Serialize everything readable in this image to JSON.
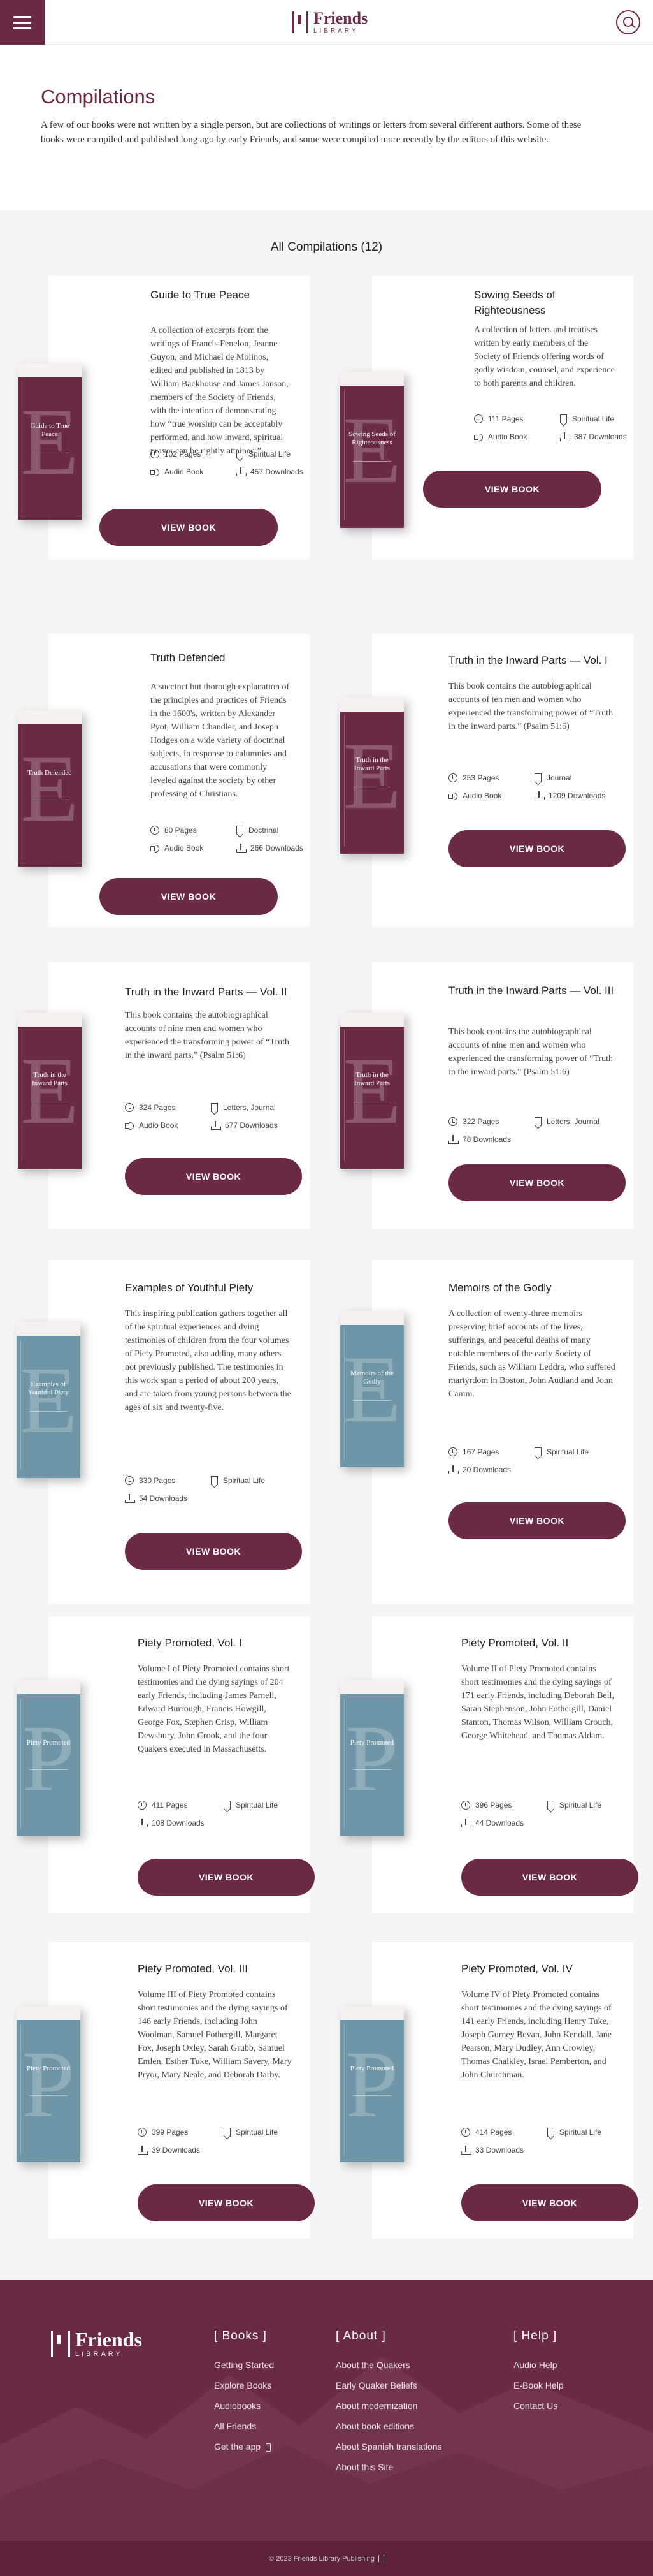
{
  "brand": {
    "name": "Friends",
    "sub": "LIBRARY"
  },
  "intro": {
    "title": "Compilations",
    "text": "A few of our books were not written by a single person, but are collections of writings or letters from several different authors. Some of these books were compiled and published long ago by early Friends, and some were compiled more recently by the editors of this website."
  },
  "count_label": "All Compilations (12)",
  "colors": {
    "accent": "#6c2b45",
    "cover_maroon": "#6b2b44",
    "cover_blue": "#6f96a6"
  },
  "books": [
    {
      "title": "Guide to True Peace",
      "cover_title": "Guide to True Peace",
      "cover_letter": "E",
      "cover_color": "maroon",
      "desc": "A collection of excerpts from the writings of Francis Fenelon, Jeanne Guyon, and Michael de Molinos, edited and published in 1813 by William Backhouse and James Janson, members of the Society of Friends, with the intention of demonstrating how “true worship can be acceptably performed, and how inward, spiritual prayer can be rightly attained.”",
      "pages": "102 Pages",
      "genre": "Spiritual Life",
      "audio": "Audio Book",
      "downloads": "457 Downloads",
      "button": "VIEW BOOK"
    },
    {
      "title": "Sowing Seeds of Righteousness",
      "cover_title": "Sowing Seeds of Righteousness",
      "cover_letter": "E",
      "cover_color": "maroon",
      "desc": "A collection of letters and treatises written by early members of the Society of Friends offering words of godly wisdom, counsel, and experience to both parents and children.",
      "pages": "111 Pages",
      "genre": "Spiritual Life",
      "audio": "Audio Book",
      "downloads": "387 Downloads",
      "button": "VIEW BOOK"
    },
    {
      "title": "Truth Defended",
      "cover_title": "Truth Defended",
      "cover_letter": "E",
      "cover_color": "maroon",
      "desc": "A succinct but thorough explanation of the principles and practices of Friends in the 1600's, written by Alexander Pyot, William Chandler, and Joseph Hodges on a wide variety of doctrinal subjects, in response to calumnies and accusations that were commonly leveled against the society by other professing of Christians.",
      "pages": "80 Pages",
      "genre": "Doctrinal",
      "audio": "Audio Book",
      "downloads": "266 Downloads",
      "button": "VIEW BOOK"
    },
    {
      "title": "Truth in the Inward Parts — Vol. I",
      "cover_title": "Truth in the Inward Parts",
      "cover_letter": "E",
      "cover_color": "maroon",
      "desc": "This book contains the autobiographical accounts of ten men and women who experienced the transforming power of “Truth in the inward parts.” (Psalm 51:6)",
      "pages": "253 Pages",
      "genre": "Journal",
      "audio": "Audio Book",
      "downloads": "1209 Downloads",
      "button": "VIEW BOOK"
    },
    {
      "title": "Truth in the Inward Parts — Vol. II",
      "cover_title": "Truth in the Inward Parts",
      "cover_letter": "E",
      "cover_color": "maroon",
      "desc": "This book contains the autobiographical accounts of nine men and women who experienced the transforming power of “Truth in the inward parts.” (Psalm 51:6)",
      "pages": "324 Pages",
      "genre": "Letters, Journal",
      "audio": "Audio Book",
      "downloads": "677 Downloads",
      "button": "VIEW BOOK"
    },
    {
      "title": "Truth in the Inward Parts — Vol. III",
      "cover_title": "Truth in the Inward Parts",
      "cover_letter": "E",
      "cover_color": "maroon",
      "desc": "This book contains the autobiographical accounts of nine men and women who experienced the transforming power of “Truth in the inward parts.” (Psalm 51:6)",
      "pages": "322 Pages",
      "genre": "Letters, Journal",
      "audio": "",
      "downloads": "78 Downloads",
      "button": "VIEW BOOK"
    },
    {
      "title": "Examples of Youthful Piety",
      "cover_title": "Examples of Youthful Piety",
      "cover_letter": "E",
      "cover_color": "blue",
      "desc": "This inspiring publication gathers together all of the spiritual experiences and dying testimonies of children from the four volumes of Piety Promoted, also adding many others not previously published. The testimonies in this work span a period of about 200 years, and are taken from young persons between the ages of six and twenty-five.",
      "pages": "330 Pages",
      "genre": "Spiritual Life",
      "audio": "",
      "downloads": "54 Downloads",
      "button": "VIEW BOOK"
    },
    {
      "title": "Memoirs of the Godly",
      "cover_title": "Memoirs of the Godly",
      "cover_letter": "E",
      "cover_color": "blue",
      "desc": "A collection of twenty-three memoirs preserving brief accounts of the lives, sufferings, and peaceful deaths of many notable members of the early Society of Friends, such as William Leddra, who suffered martyrdom in Boston, John Audland and John Camm.",
      "pages": "167 Pages",
      "genre": "Spiritual Life",
      "audio": "",
      "downloads": "20 Downloads",
      "button": "VIEW BOOK"
    },
    {
      "title": "Piety Promoted, Vol. I",
      "cover_title": "Piety Promoted",
      "cover_letter": "P",
      "cover_color": "blue",
      "desc": "Volume I of Piety Promoted contains short testimonies and the dying sayings of 204 early Friends, including James Parnell, Edward Burrough, Francis Howgill, George Fox, Stephen Crisp, William Dewsbury, John Crook, and the four Quakers executed in Massachusetts.",
      "pages": "411 Pages",
      "genre": "Spiritual Life",
      "audio": "",
      "downloads": "108 Downloads",
      "button": "VIEW BOOK"
    },
    {
      "title": "Piety Promoted, Vol. II",
      "cover_title": "Piety Promoted",
      "cover_letter": "P",
      "cover_color": "blue",
      "desc": "Volume II of Piety Promoted contains short testimonies and the dying sayings of 171 early Friends, including Deborah Bell, Sarah Stephenson, John Fothergill, Daniel Stanton, Thomas Wilson, William Crouch, George Whitehead, and Thomas Aldam.",
      "pages": "396 Pages",
      "genre": "Spiritual Life",
      "audio": "",
      "downloads": "44 Downloads",
      "button": "VIEW BOOK"
    },
    {
      "title": "Piety Promoted, Vol. III",
      "cover_title": "Piety Promoted",
      "cover_letter": "P",
      "cover_color": "blue",
      "desc": "Volume III of Piety Promoted contains short testimonies and the dying sayings of 146 early Friends, including John Woolman, Samuel Fothergill, Margaret Fox, Joseph Oxley, Sarah Grubb, Samuel Emlen, Esther Tuke, William Savery, Mary Pryor, Mary Neale, and Deborah Darby.",
      "pages": "399 Pages",
      "genre": "Spiritual Life",
      "audio": "",
      "downloads": "39 Downloads",
      "button": "VIEW BOOK"
    },
    {
      "title": "Piety Promoted, Vol. IV",
      "cover_title": "Piety Promoted",
      "cover_letter": "P",
      "cover_color": "blue",
      "desc": "Volume IV of Piety Promoted contains short testimonies and the dying sayings of 141 early Friends, including Henry Tuke, Joseph Gurney Bevan, John Kendall, Jane Pearson, Mary Dudley, Ann Crowley, Thomas Chalkley, Israel Pemberton, and John Churchman.",
      "pages": "414 Pages",
      "genre": "Spiritual Life",
      "audio": "",
      "downloads": "33 Downloads",
      "button": "VIEW BOOK"
    }
  ],
  "footer": {
    "books": {
      "heading": "[ Books ]",
      "links": [
        "Getting Started",
        "Explore Books",
        "Audiobooks",
        "All Friends",
        "Get the app"
      ]
    },
    "about": {
      "heading": "[ About ]",
      "links": [
        "About the Quakers",
        "Early Quaker Beliefs",
        "About modernization",
        "About book editions",
        "About Spanish translations",
        "About this Site"
      ]
    },
    "help": {
      "heading": "[ Help ]",
      "links": [
        "Audio Help",
        "E-Book Help",
        "Contact Us"
      ]
    },
    "copyright": "© 2023 Friends Library Publishing"
  }
}
